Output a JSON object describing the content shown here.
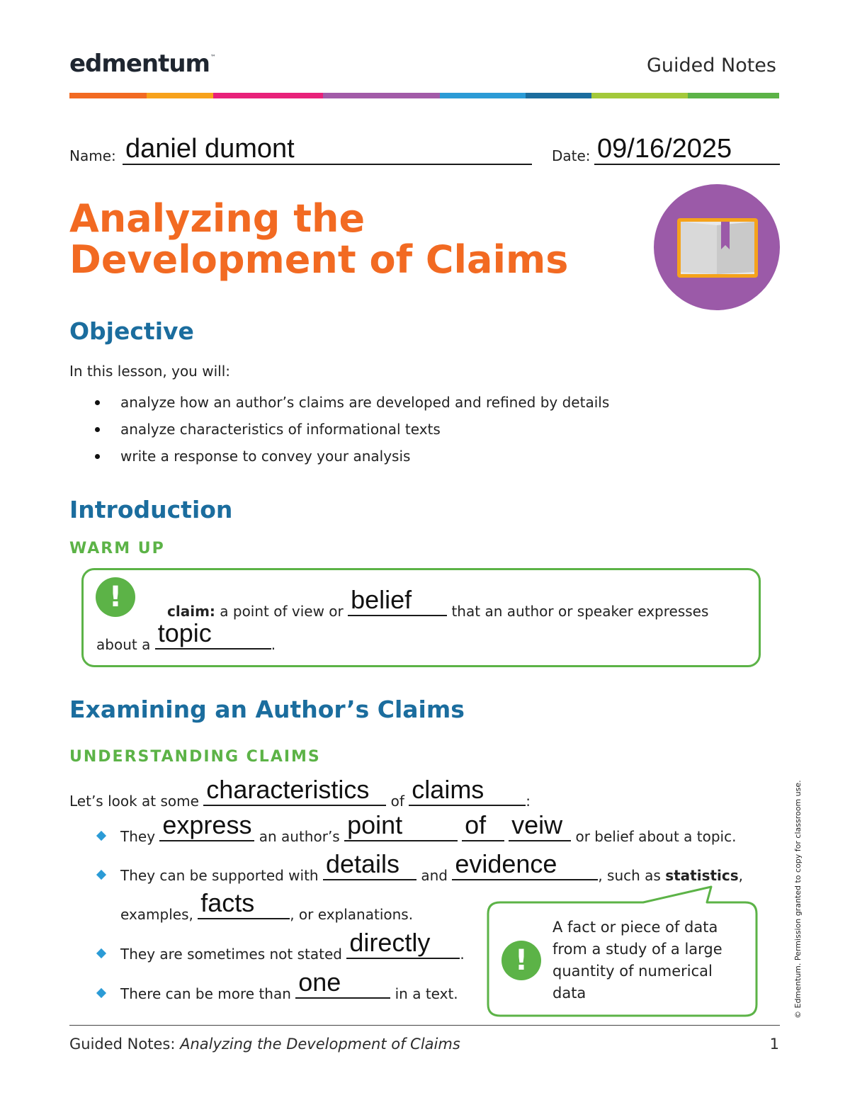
{
  "header": {
    "logo_text": "edmentum",
    "logo_tm": "™",
    "doc_type": "Guided Notes",
    "stripe_colors": [
      "#f26a22",
      "#f7a21b",
      "#e8217a",
      "#a25ba8",
      "#2b9bd6",
      "#1b6d9e",
      "#a3c93a",
      "#5cb347"
    ]
  },
  "student": {
    "name_label": "Name:",
    "name_value": "daniel dumont",
    "date_label": "Date:",
    "date_value": "09/16/2025"
  },
  "title": {
    "line1": "Analyzing the",
    "line2": "Development of Claims"
  },
  "objective": {
    "heading": "Objective",
    "intro": "In this lesson, you will:",
    "items": [
      "analyze how an author’s claims are developed and refined by details",
      "analyze characteristics of informational texts",
      "write a response to convey your analysis"
    ]
  },
  "introduction": {
    "heading": "Introduction",
    "subheading": "WARM UP",
    "term": "claim:",
    "text1": " a point of view or ",
    "blank1": "belief",
    "text2": " that an author or speaker expresses",
    "text3": "about a ",
    "blank2": "topic",
    "text4": "."
  },
  "examining": {
    "heading": "Examining an Author’s Claims",
    "subheading": "UNDERSTANDING CLAIMS",
    "intro_text1": "Let’s look at some ",
    "intro_blank1": "characteristics",
    "intro_text2": " of ",
    "intro_blank2": "claims",
    "intro_text3": ":",
    "b1_text1": "They ",
    "b1_blank1": "express",
    "b1_text2": " an author’s ",
    "b1_blank2": "point",
    "b1_blank3": "of",
    "b1_blank4": "veiw",
    "b1_text3": " or belief about a topic.",
    "b2_text1": "They can be supported with ",
    "b2_blank1": "details",
    "b2_text2": " and ",
    "b2_blank2": "evidence",
    "b2_text3": ", such as ",
    "b2_bold": "statistics",
    "b2_text4": ",",
    "b2b_text1": "examples, ",
    "b2b_blank1": "facts",
    "b2b_text2": ", or explanations.",
    "b3_text1": "They are sometimes not stated ",
    "b3_blank1": "directly",
    "b3_text2": ".",
    "b4_text1": "There can be more than ",
    "b4_blank1": "one",
    "b4_text2": " in a text.",
    "callout": "A fact or piece of data from a study of a large quantity of numerical data"
  },
  "footer": {
    "label": "Guided Notes: ",
    "title_italic": "Analyzing the Development of Claims",
    "page": "1",
    "side_note": "© Edmentum. Permission granted to copy for classroom use."
  }
}
